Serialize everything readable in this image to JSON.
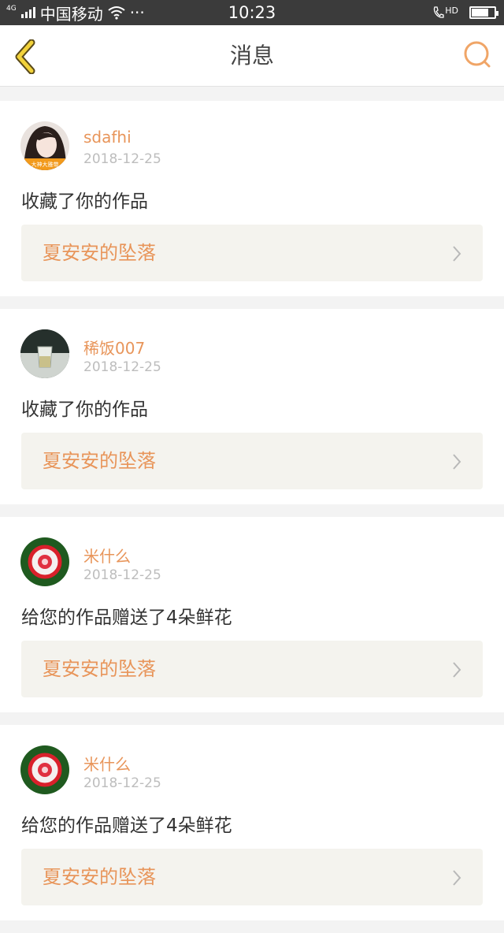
{
  "status_bar": {
    "network": "4G",
    "carrier": "中国移动",
    "more": "···",
    "time": "10:23",
    "call_badge": "HD",
    "battery_level": 0.75
  },
  "header": {
    "title": "消息",
    "back_icon": "chevron-left-icon",
    "search_icon": "search-icon",
    "accent_color": "#e8955a"
  },
  "messages": [
    {
      "username": "sdafhi",
      "date": "2018-12-25",
      "action": "收藏了你的作品",
      "work_title": "夏安安的坠落",
      "avatar_text": "大神大雅带",
      "avatar": "portrait-avatar"
    },
    {
      "username": "稀饭007",
      "date": "2018-12-25",
      "action": "收藏了你的作品",
      "work_title": "夏安安的坠落",
      "avatar": "glass-avatar"
    },
    {
      "username": "米什么",
      "date": "2018-12-25",
      "action": "给您的作品赠送了4朵鲜花",
      "work_title": "夏安安的坠落",
      "avatar": "flower-avatar"
    },
    {
      "username": "米什么",
      "date": "2018-12-25",
      "action": "给您的作品赠送了4朵鲜花",
      "work_title": "夏安安的坠落",
      "avatar": "flower-avatar"
    }
  ]
}
